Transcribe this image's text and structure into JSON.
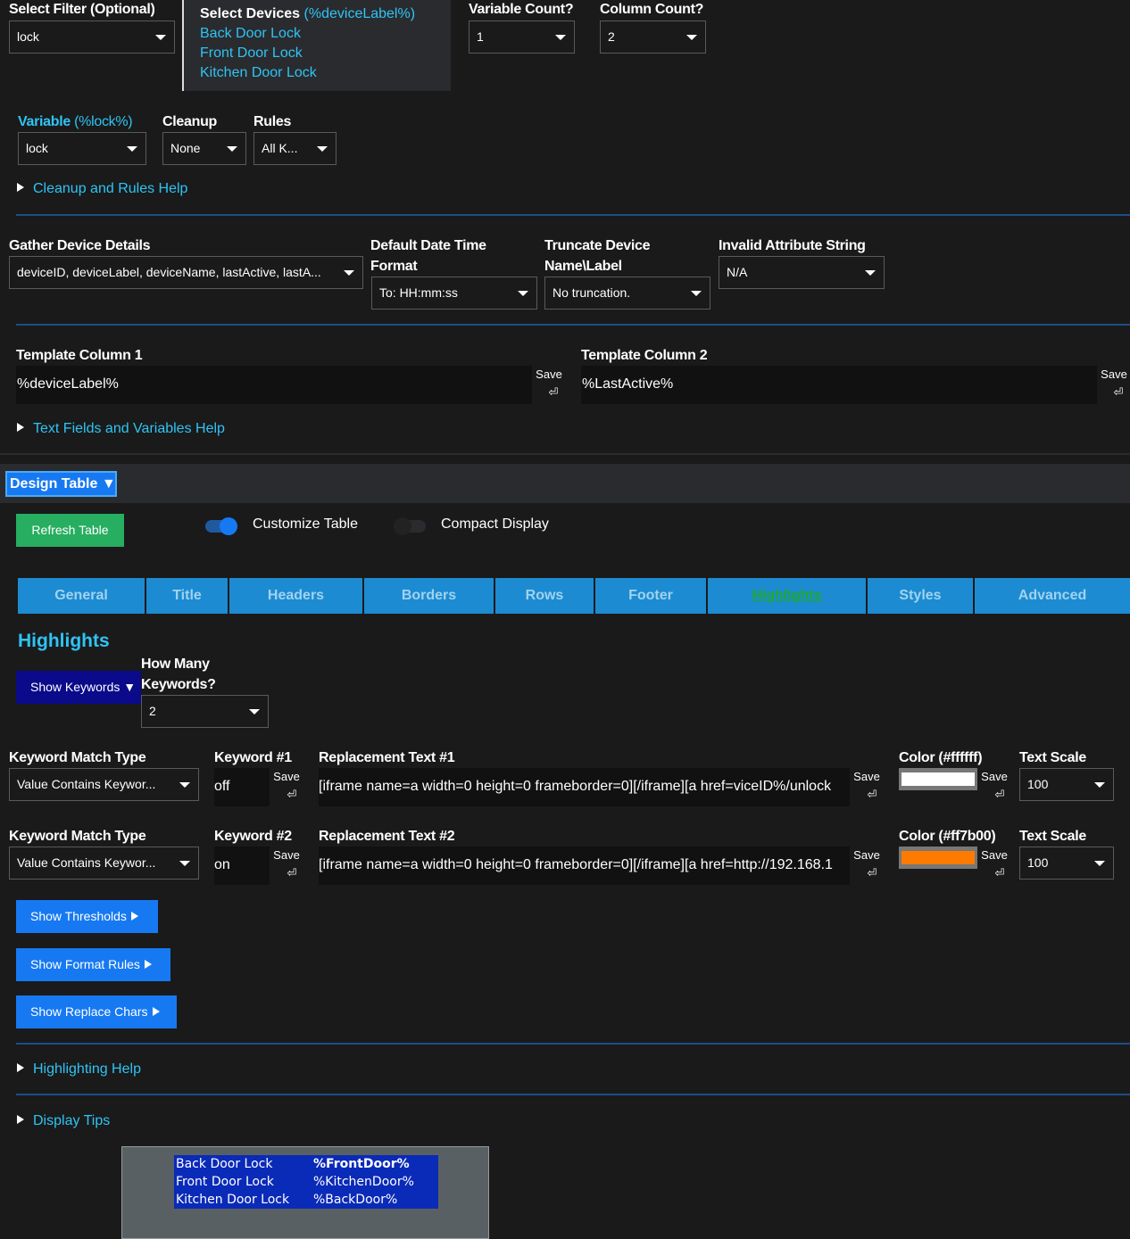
{
  "filter": {
    "label": "Select Filter (Optional)",
    "value": "lock"
  },
  "devices": {
    "title": "Select Devices",
    "hint": "(%deviceLabel%)",
    "items": [
      "Back Door Lock",
      "Front Door Lock",
      "Kitchen Door Lock"
    ]
  },
  "variable_count": {
    "label": "Variable Count?",
    "value": "1"
  },
  "column_count": {
    "label": "Column Count?",
    "value": "2"
  },
  "variable": {
    "label": "Variable",
    "hint": "(%lock%)",
    "value": "lock"
  },
  "cleanup": {
    "label": "Cleanup",
    "value": "None"
  },
  "rules": {
    "label": "Rules",
    "value": "All K..."
  },
  "cleanup_help": "Cleanup and Rules Help",
  "gather": {
    "label": "Gather Device Details",
    "value": "deviceID, deviceLabel, deviceName, lastActive, lastA..."
  },
  "date_format": {
    "label_1": "Default Date Time",
    "label_2": "Format",
    "value": "To: HH:mm:ss"
  },
  "truncate": {
    "label_1": "Truncate Device",
    "label_2": "Name\\Label",
    "value": "No truncation."
  },
  "invalid": {
    "label": "Invalid Attribute String",
    "value": "N/A"
  },
  "template1": {
    "label": "Template Column 1",
    "value": "%deviceLabel%"
  },
  "template2": {
    "label": "Template Column 2",
    "value": "%LastActive%"
  },
  "save_label": "Save",
  "enter_glyph": "⏎",
  "text_help": "Text Fields and Variables Help",
  "design_table": "Design Table ▼",
  "refresh": "Refresh Table",
  "customize": {
    "label": "Customize Table",
    "on": true
  },
  "compact": {
    "label": "Compact Display",
    "on": false
  },
  "tabs": [
    "General",
    "Title",
    "Headers",
    "Borders",
    "Rows",
    "Footer",
    "Highlights",
    "Styles",
    "Advanced"
  ],
  "active_tab": "Highlights",
  "highlights_title": "Highlights",
  "show_keywords": "Show Keywords ▼",
  "how_many": {
    "label_1": "How Many",
    "label_2": "Keywords?",
    "value": "2"
  },
  "keywords": [
    {
      "match_label": "Keyword Match Type",
      "match_value": "Value Contains Keywor...",
      "kw_label": "Keyword #1",
      "kw_value": "off",
      "repl_label": "Replacement Text #1",
      "repl_value": "[iframe name=a width=0 height=0 frameborder=0][/iframe][a href=viceID%/unlock",
      "color_label": "Color (#ffffff)",
      "color": "#ffffff",
      "scale_label": "Text Scale",
      "scale_value": "100"
    },
    {
      "match_label": "Keyword Match Type",
      "match_value": "Value Contains Keywor...",
      "kw_label": "Keyword #2",
      "kw_value": "on",
      "repl_label": "Replacement Text #2",
      "repl_value": "[iframe name=a width=0 height=0 frameborder=0][/iframe][a href=http://192.168.1",
      "color_label": "Color (#ff7b00)",
      "color": "#ff7b00",
      "scale_label": "Text Scale",
      "scale_value": "100"
    }
  ],
  "show_thresholds": "Show Thresholds",
  "show_format": "Show Format Rules",
  "show_replace": "Show Replace Chars",
  "highlighting_help": "Highlighting Help",
  "display_tips": "Display Tips",
  "preview": [
    [
      "Back Door Lock",
      "%FrontDoor%"
    ],
    [
      "Front Door Lock",
      "%KitchenDoor%"
    ],
    [
      "Kitchen Door Lock",
      "%BackDoor%"
    ]
  ]
}
